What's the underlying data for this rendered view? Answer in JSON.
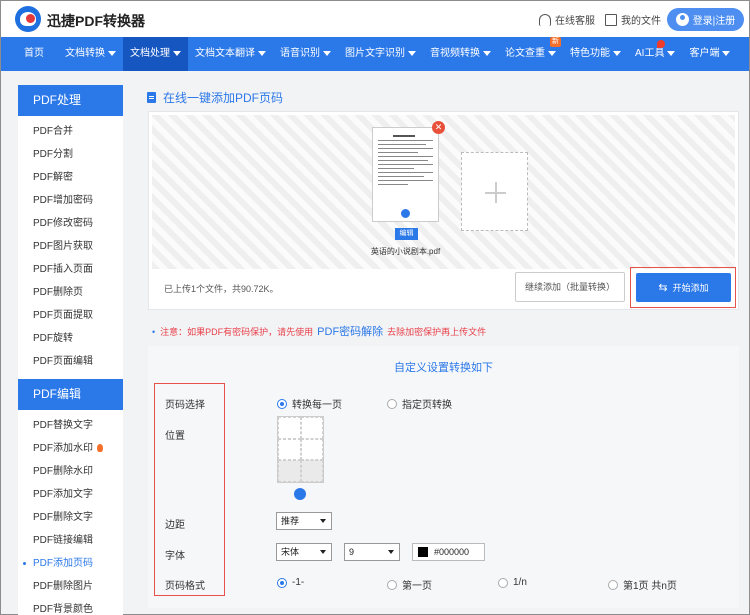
{
  "header": {
    "brand": "迅捷PDF转换器",
    "service_label": "在线客服",
    "docs_label": "我的文件",
    "login_label": "登录|注册"
  },
  "nav": {
    "items": [
      {
        "label": "首页",
        "caret": false
      },
      {
        "label": "文档转换",
        "caret": true
      },
      {
        "label": "文档处理",
        "caret": true,
        "active": true
      },
      {
        "label": "文档文本翻译",
        "caret": true
      },
      {
        "label": "语音识别",
        "caret": true
      },
      {
        "label": "图片文字识别",
        "caret": true
      },
      {
        "label": "音视频转换",
        "caret": true
      },
      {
        "label": "论文查重",
        "caret": true,
        "badge": "新"
      },
      {
        "label": "特色功能",
        "caret": true
      },
      {
        "label": "AI工具",
        "caret": true,
        "hot": true
      },
      {
        "label": "客户端",
        "caret": true
      }
    ]
  },
  "sidebar": {
    "group1_title": "PDF处理",
    "group1_items": [
      "PDF合并",
      "PDF分割",
      "PDF解密",
      "PDF增加密码",
      "PDF修改密码",
      "PDF图片获取",
      "PDF插入页面",
      "PDF删除页",
      "PDF页面提取",
      "PDF旋转",
      "PDF页面编辑"
    ],
    "group2_title": "PDF编辑",
    "group2_items": [
      "PDF替换文字",
      "PDF添加水印",
      "PDF删除水印",
      "PDF添加文字",
      "PDF删除文字",
      "PDF链接编辑",
      "PDF添加页码",
      "PDF删除图片",
      "PDF背景颜色"
    ],
    "active_item": "PDF添加页码"
  },
  "page_title": "在线一键添加PDF页码",
  "upload": {
    "file_name": "英语的小说剧本.pdf",
    "edit_label": "编辑",
    "remove_icon": "✕",
    "status": "已上传1个文件，共90.72K。",
    "continue_label": "继续添加（批量转换）",
    "start_label": "开始添加"
  },
  "notice": {
    "prefix": "注意：如果PDF有密码保护，请先使用",
    "link": "PDF密码解除",
    "suffix": "去除加密保护再上传文件"
  },
  "settings": {
    "title": "自定义设置转换如下",
    "page_select_label": "页码选择",
    "page_select_options": [
      "转换每一页",
      "指定页转换"
    ],
    "position_label": "位置",
    "margin_label": "边距",
    "margin_value": "推荐",
    "font_label": "字体",
    "font_value": "宋体",
    "font_size_value": "9",
    "color_value": "#000000",
    "format_label": "页码格式",
    "format_options": [
      "-1-",
      "第一页",
      "1/n",
      "第1页 共n页"
    ]
  },
  "colors": {
    "primary": "#2b78e8",
    "highlight_frame": "#e8504a",
    "notice": "#e8404a"
  }
}
